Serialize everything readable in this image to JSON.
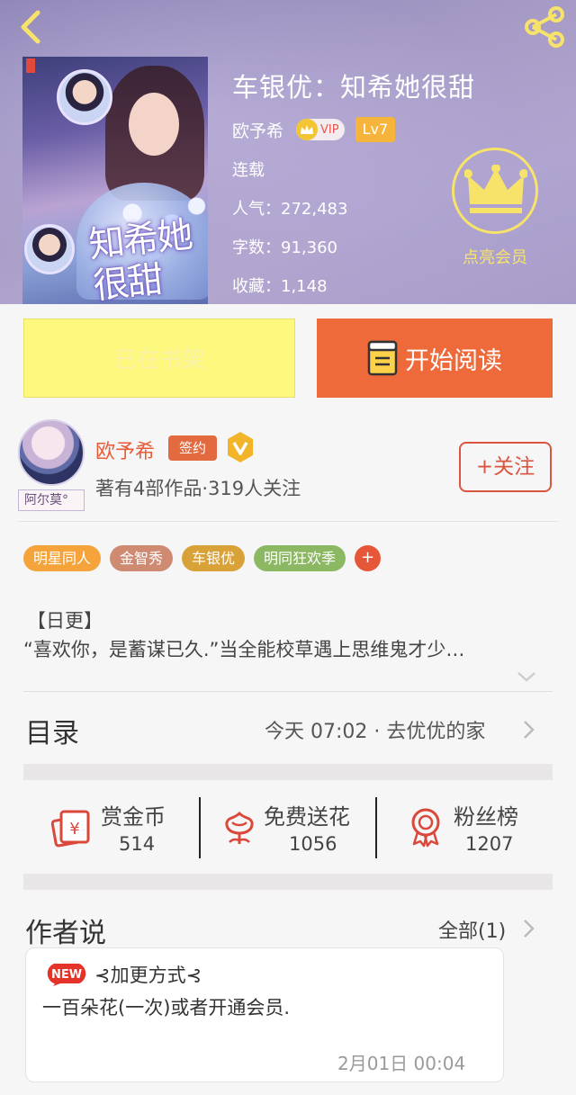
{
  "header": {
    "book_title": "车银优：知希她很甜",
    "author": "欧予希",
    "vip_label": "VIP",
    "level": "Lv7",
    "status": "连载",
    "popularity_label": "人气：",
    "popularity": "272,483",
    "words_label": "字数：",
    "words": "91,360",
    "favorites_label": "收藏：",
    "favorites": "1,148",
    "member_label": "点亮会员",
    "cover_title": "知希她很甜"
  },
  "actions": {
    "shelf_label": "已在书架",
    "read_label": "开始阅读"
  },
  "author_card": {
    "name": "欧予希",
    "sign_label": "签约",
    "stats": "著有4部作品·319人关注",
    "follow_label": "+关注",
    "avatar_tag": "阿尔莫°"
  },
  "tags": [
    {
      "label": "明星同人",
      "color": "#f4a43a"
    },
    {
      "label": "金智秀",
      "color": "#cf8a72"
    },
    {
      "label": "车银优",
      "color": "#d9a238"
    },
    {
      "label": "明同狂欢季",
      "color": "#8cb864"
    }
  ],
  "tag_more": "+",
  "intro": {
    "line1": "【日更】",
    "line2": "“喜欢你，是蓄谋已久.”当全能校草遇上思维鬼才少…"
  },
  "catalog": {
    "title": "目录",
    "latest": "今天 07:02 · 去优优的家"
  },
  "stats": {
    "reward_label": "赏金币",
    "reward_count": "514",
    "flower_label": "免费送花",
    "flower_count": "1056",
    "fans_label": "粉丝榜",
    "fans_count": "1207"
  },
  "author_says": {
    "title": "作者说",
    "all_label": "全部(1)",
    "new_badge": "NEW",
    "note_title": "⊰加更方式⊰",
    "note_body": "一百朵花(一次)或者开通会员.",
    "note_time": "2月01日  00:04"
  },
  "colors": {
    "accent": "#ee6a3b",
    "shelf_bg": "#fdf87e",
    "member_gold": "#f7e36a",
    "header_purple": "#a69bc6"
  }
}
